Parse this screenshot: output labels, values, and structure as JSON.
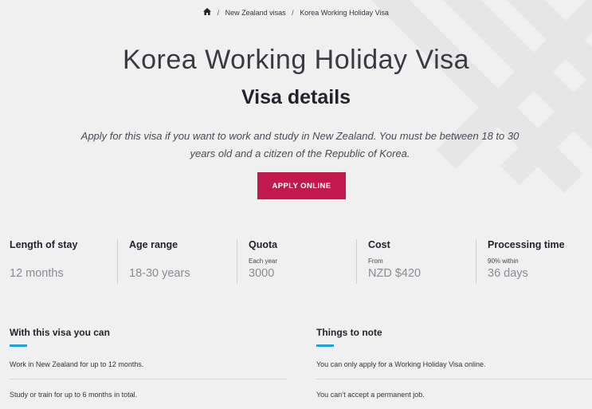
{
  "breadcrumb": {
    "home_icon": "home-icon",
    "separator": "/",
    "items": [
      "New Zealand visas",
      "Korea Working Holiday Visa"
    ]
  },
  "title": "Korea Working Holiday Visa",
  "subtitle": "Visa details",
  "intro": "Apply for this visa if you want to work and study in New Zealand. You must be between 18 to 30 years old and a citizen of the Republic of Korea.",
  "apply_button": "APPLY ONLINE",
  "facts": [
    {
      "label": "Length of stay",
      "note": "",
      "value": "12 months"
    },
    {
      "label": "Age range",
      "note": "",
      "value": "18-30 years"
    },
    {
      "label": "Quota",
      "note": "Each year",
      "value": "3000"
    },
    {
      "label": "Cost",
      "note": "From",
      "value": "NZD $420"
    },
    {
      "label": "Processing time",
      "note": "90% within",
      "value": "36 days"
    }
  ],
  "can": {
    "heading": "With this visa you can",
    "items": [
      "Work in New Zealand for up to 12 months.",
      "Study or train for up to 6 months in total."
    ]
  },
  "note": {
    "heading": "Things to note",
    "items": [
      "You can only apply for a Working Holiday Visa online.",
      "You can’t accept a permanent job."
    ]
  },
  "colors": {
    "background": "#f0f0f0",
    "button": "#c1184e",
    "accent": "#1fa2e0",
    "heading": "#23232e",
    "muted_value": "#8a8a93"
  }
}
